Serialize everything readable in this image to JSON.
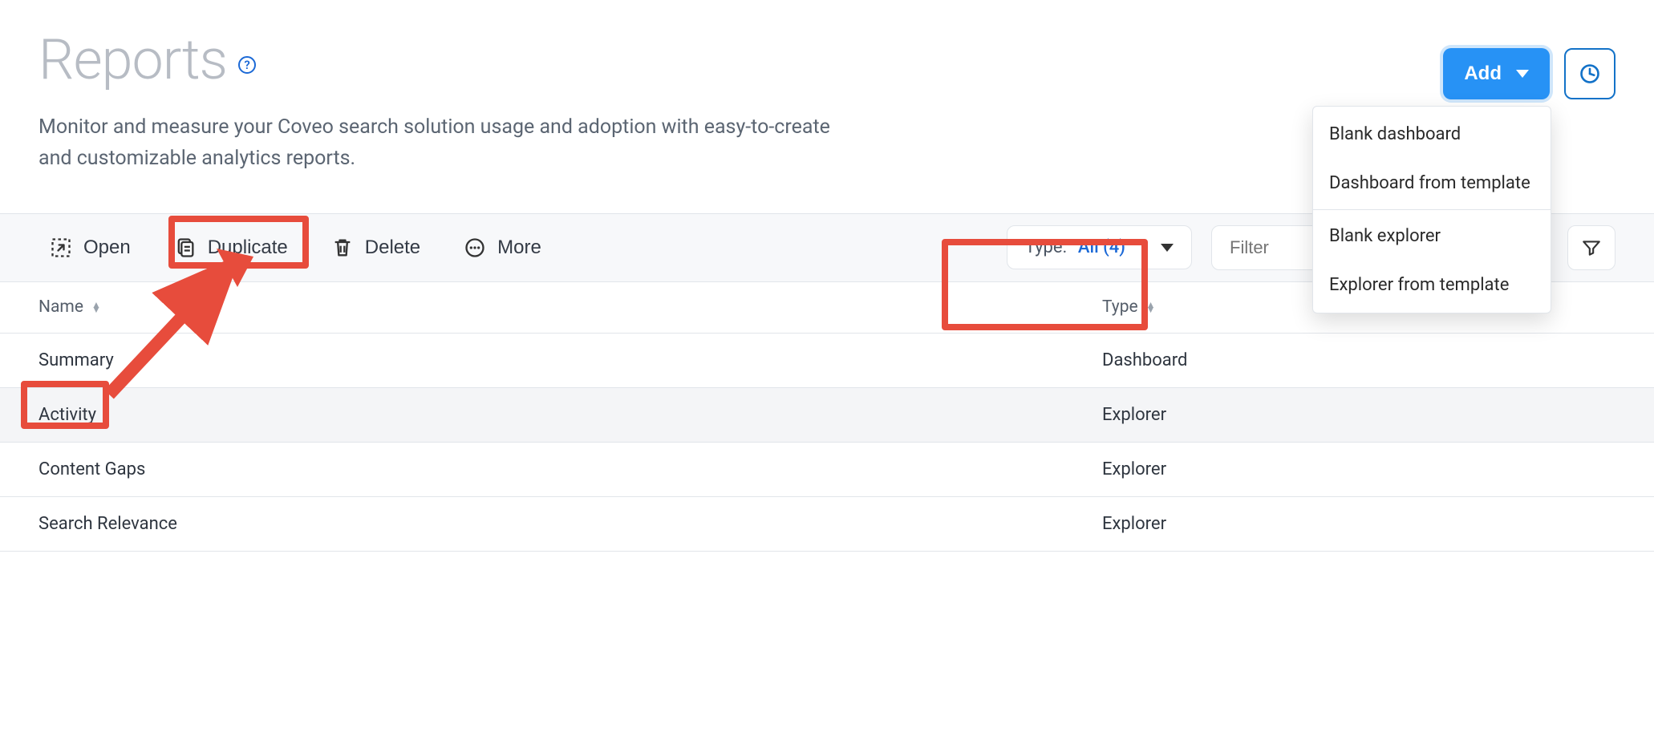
{
  "header": {
    "title": "Reports",
    "subtitle": "Monitor and measure your Coveo search solution usage and adoption with easy-to-create and customizable analytics reports.",
    "help_tooltip": "?"
  },
  "actions": {
    "add_label": "Add",
    "history_tooltip": "History"
  },
  "add_menu": {
    "items": [
      {
        "label": "Blank dashboard"
      },
      {
        "label": "Dashboard from template"
      },
      {
        "label": "Blank explorer"
      },
      {
        "label": "Explorer from template"
      }
    ]
  },
  "toolbar": {
    "open_label": "Open",
    "duplicate_label": "Duplicate",
    "delete_label": "Delete",
    "more_label": "More"
  },
  "filters": {
    "type_label": "Type:",
    "type_value": "All (4)",
    "filter_placeholder": "Filter",
    "funnel_tooltip": "Advanced filters"
  },
  "table": {
    "columns": {
      "name": "Name",
      "type": "Type"
    },
    "rows": [
      {
        "name": "Summary",
        "type": "Dashboard",
        "selected": false
      },
      {
        "name": "Activity",
        "type": "Explorer",
        "selected": true
      },
      {
        "name": "Content Gaps",
        "type": "Explorer",
        "selected": false
      },
      {
        "name": "Search Relevance",
        "type": "Explorer",
        "selected": false
      }
    ]
  },
  "annotation_colors": {
    "highlight": "#e74c3c"
  }
}
